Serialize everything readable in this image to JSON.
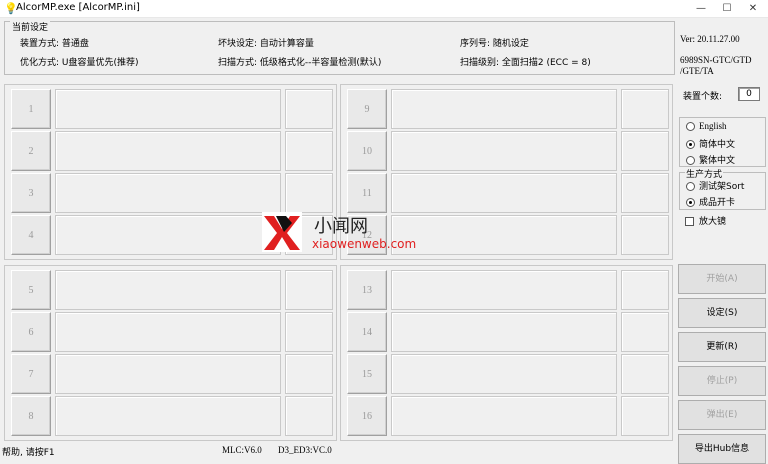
{
  "window": {
    "title": "AlcorMP.exe [AlcorMP.ini]",
    "icon": "lightbulb-icon",
    "buttons": [
      "—",
      "☐",
      "✕"
    ]
  },
  "settings": {
    "legend": "当前设定",
    "device_mode": "装置方式: 普通盘",
    "bad_block": "坏块设定: 自动计算容量",
    "serial": "序列号: 随机设定",
    "optimize": "优化方式: U盘容量优先(推荐)",
    "scan_mode": "扫描方式: 低级格式化--半容量检测(默认)",
    "scan_level": "扫描级别: 全面扫描2 (ECC = 8)"
  },
  "side": {
    "version": "Ver: 20.11.27.00",
    "chip_line1": "6989SN-GTC/GTD",
    "chip_line2": "/GTE/TA",
    "device_count_label": "装置个数:",
    "device_count": "0"
  },
  "language": {
    "options": [
      "English",
      "简体中文",
      "繁体中文"
    ],
    "selected": 1
  },
  "production": {
    "legend": "生产方式",
    "options": [
      "测试架Sort",
      "成品开卡"
    ],
    "selected": 1
  },
  "magnifier": {
    "label": "放大镜",
    "checked": false
  },
  "buttons": {
    "start": "开始(A)",
    "settings": "设定(S)",
    "refresh": "更新(R)",
    "stop": "停止(P)",
    "eject": "弹出(E)",
    "export_hub": "导出Hub信息"
  },
  "slots": {
    "top_left": [
      "1",
      "2",
      "3",
      "4"
    ],
    "bottom_left": [
      "5",
      "6",
      "7",
      "8"
    ],
    "top_right": [
      "9",
      "10",
      "11",
      "12"
    ],
    "bottom_right": [
      "13",
      "14",
      "15",
      "16"
    ]
  },
  "status": {
    "help": "帮助, 请按F1",
    "mlc": "MLC:V6.0",
    "d3": "D3_ED3:VC.0"
  },
  "watermark": {
    "cn": "小闻网",
    "en": "xiaowenweb.com"
  },
  "colors": {
    "watermark_red": "#e02020",
    "disabled_text": "#a0a0a0"
  }
}
